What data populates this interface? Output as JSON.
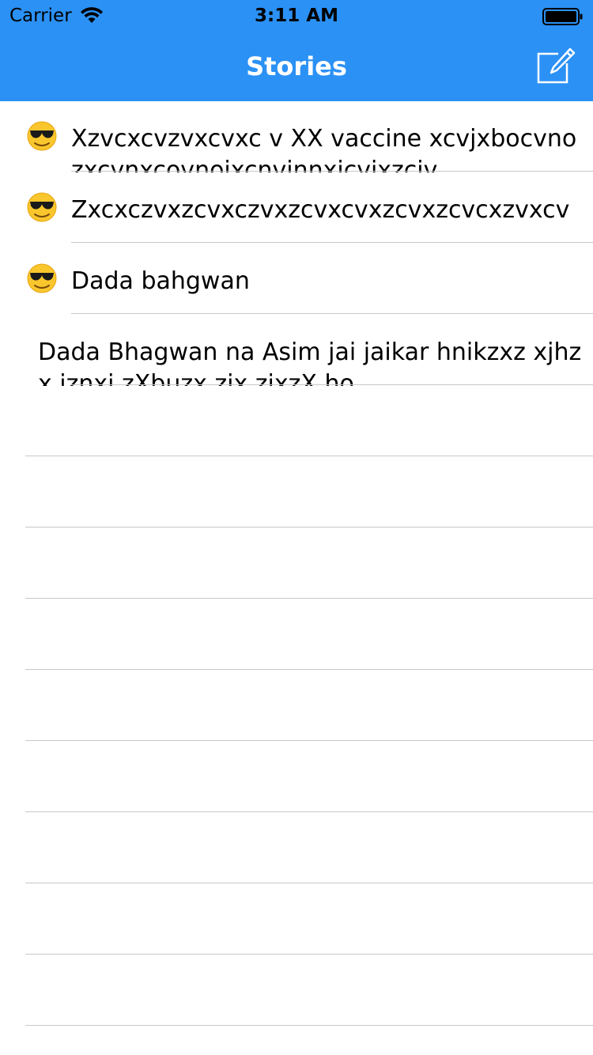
{
  "status_bar": {
    "carrier": "Carrier",
    "time": "3:11 AM",
    "wifi_icon": "wifi-icon",
    "battery_icon": "battery-full-icon"
  },
  "nav": {
    "title": "Stories",
    "compose_icon": "compose-icon",
    "background_color": "#2b91f5",
    "title_color": "#ffffff"
  },
  "stories": [
    {
      "icon": "smiling-face-with-sunglasses-emoji",
      "text": "Xzvcxcvzvxcvxc v XX vaccine xcvjxbocvnozxcvnxcovnojxcnvjnnxjcvjxzcjv"
    },
    {
      "icon": "smiling-face-with-sunglasses-emoji",
      "text": "Zxcxczvxzcvxczvxzcvxcvxzcvxzcvcxzvxcv"
    },
    {
      "icon": "smiling-face-with-sunglasses-emoji",
      "text": "Dada bahgwan"
    },
    {
      "icon": "",
      "text": "Dada Bhagwan na Asim jai jaikar hnikzxz xjhzx iznxj zXbuzx zjx zjxzX  ho"
    }
  ],
  "separator_color": "#c8c7cc"
}
